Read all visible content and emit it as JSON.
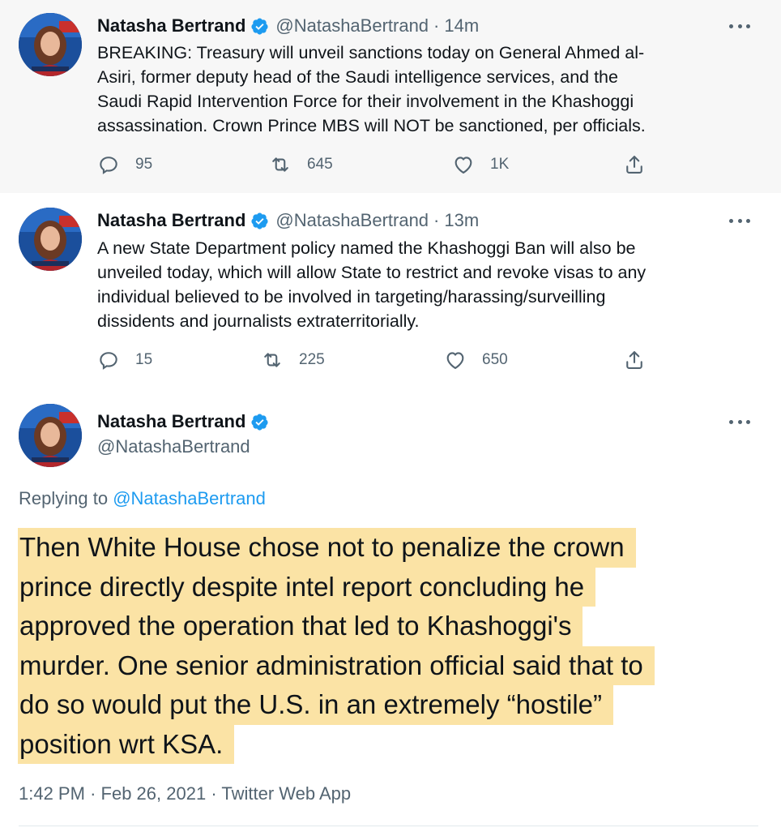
{
  "colors": {
    "accent": "#1d9bf0",
    "verified": "#1d9bf0",
    "highlight": "#fbe3a5",
    "muted": "#536471"
  },
  "tweets": [
    {
      "name": "Natasha Bertrand",
      "handle": "@NatashaBertrand",
      "separator": "·",
      "time": "14m",
      "text": "BREAKING: Treasury will unveil sanctions today on General Ahmed al-\nAsiri, former deputy head of the Saudi intelligence services, and the\nSaudi Rapid Intervention Force for their involvement in the Khashoggi\nassassination. Crown Prince MBS will NOT be sanctioned, per officials.",
      "replies": "95",
      "retweets": "645",
      "likes": "1K"
    },
    {
      "name": "Natasha Bertrand",
      "handle": "@NatashaBertrand",
      "separator": "·",
      "time": "13m",
      "text": "A new State Department policy named the Khashoggi Ban will also be\nunveiled today, which will allow State to restrict and revoke visas to any\nindividual believed to be involved in  targeting/harassing/surveilling\ndissidents and journalists extraterritorially.",
      "replies": "15",
      "retweets": "225",
      "likes": "650"
    }
  ],
  "main_tweet": {
    "name": "Natasha Bertrand",
    "handle": "@NatashaBertrand",
    "replying_prefix": "Replying to",
    "replying_to": "@NatashaBertrand",
    "lines": [
      "Then White House chose not to penalize the crown",
      "prince directly despite intel report concluding he",
      "approved the operation that led to Khashoggi's",
      "murder. One senior administration official said that to",
      "do so would put the U.S. in an extremely “hostile”",
      "position wrt KSA."
    ],
    "time": "1:42 PM",
    "date": "Feb 26, 2021",
    "source": "Twitter Web App",
    "separator": "·"
  },
  "icons": {
    "reply": "reply-icon",
    "retweet": "retweet-icon",
    "like": "heart-icon",
    "share": "share-icon",
    "verified": "verified-badge-icon",
    "more": "more-options-icon"
  }
}
